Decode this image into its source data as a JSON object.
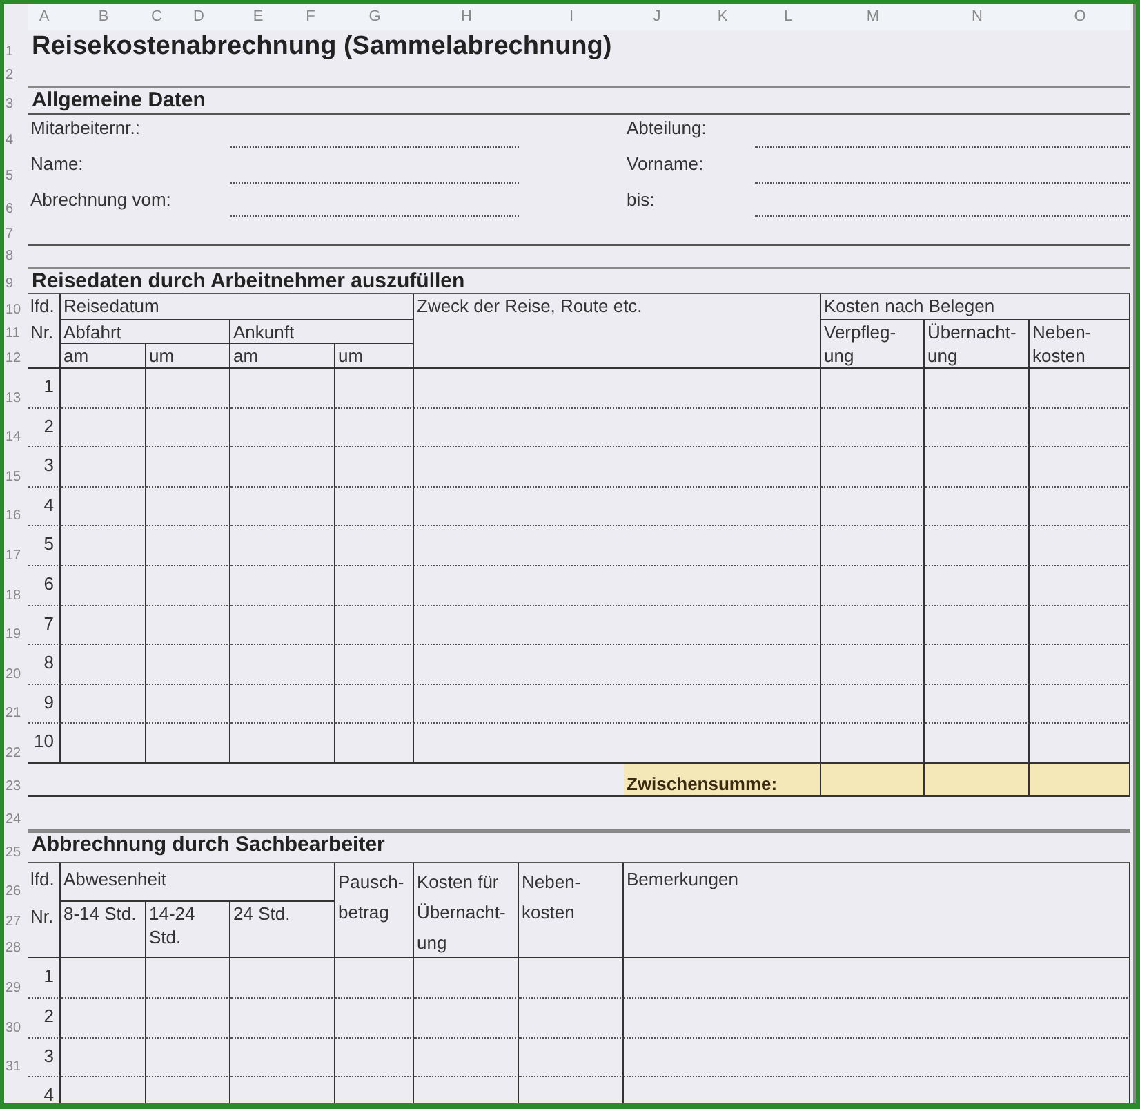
{
  "column_headers": [
    "A",
    "B",
    "C",
    "D",
    "E",
    "F",
    "G",
    "H",
    "I",
    "J",
    "K",
    "L",
    "M",
    "N",
    "O"
  ],
  "row_headers": [
    "1",
    "2",
    "3",
    "4",
    "5",
    "6",
    "7",
    "8",
    "9",
    "10",
    "11",
    "12",
    "13",
    "14",
    "15",
    "16",
    "17",
    "18",
    "19",
    "20",
    "21",
    "22",
    "23",
    "24",
    "25",
    "26",
    "27",
    "28",
    "29",
    "30",
    "31"
  ],
  "title": "Reisekostenabrechnung (Sammelabrechnung)",
  "general": {
    "heading": "Allgemeine Daten",
    "fields": [
      {
        "label": "Mitarbeiternr.:"
      },
      {
        "label": "Abteilung:"
      },
      {
        "label": "Name:"
      },
      {
        "label": "Vorname:"
      },
      {
        "label": "Abrechnung vom:"
      },
      {
        "label": "bis:"
      }
    ]
  },
  "travel": {
    "heading": "Reisedaten durch Arbeitnehmer auszufüllen",
    "header_cells": [
      "lfd.",
      "Reisedatum",
      "Zweck der Reise, Route etc.",
      "Kosten nach Belegen",
      "Nr.",
      "Abfahrt",
      "Ankunft",
      "am",
      "um",
      "am",
      "um",
      "Verpfleg-\nung",
      "Übernacht-\nung",
      "Neben-\nkosten"
    ],
    "rows": [
      {
        "number": "1"
      },
      {
        "number": "2"
      },
      {
        "number": "3"
      },
      {
        "number": "4"
      },
      {
        "number": "5"
      },
      {
        "number": "6"
      },
      {
        "number": "7"
      },
      {
        "number": "8"
      },
      {
        "number": "9"
      },
      {
        "number": "10"
      }
    ],
    "subtotal_label": "Zwischensumme:"
  },
  "settlement": {
    "heading": "Abbrechnung durch Sachbearbeiter",
    "header_cells": [
      "lfd.",
      "Abwesenheit",
      "Pausch-\nbetrag",
      "Kosten für\nÜbernacht-\nung",
      "Neben-\nkosten",
      "Bemerkungen",
      "Nr.",
      "8-14 Std.",
      "14-24\nStd.",
      "24 Std."
    ],
    "rows": [
      {
        "number": "1"
      },
      {
        "number": "2"
      },
      {
        "number": "3"
      },
      {
        "number": "4"
      }
    ]
  }
}
